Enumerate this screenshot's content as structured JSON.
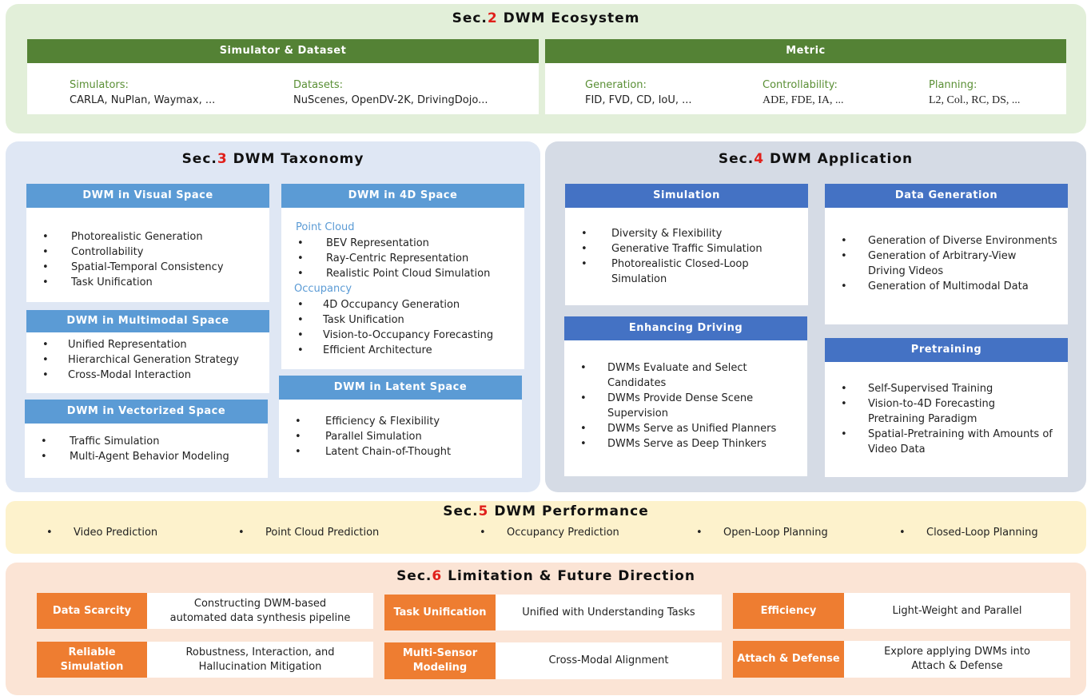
{
  "ecosystem": {
    "title_prefix": "Sec.",
    "num": "2",
    "title": "DWM Ecosystem",
    "sim_header": "Simulator & Dataset",
    "metric_header": "Metric",
    "simulators_label": "Simulators:",
    "simulators_value": "CARLA, NuPlan, Waymax, ...",
    "datasets_label": "Datasets:",
    "datasets_value": "NuScenes, OpenDV-2K, DrivingDojo...",
    "generation_label": "Generation:",
    "generation_value": "FID, FVD, CD, IoU, ...",
    "controllability_label": "Controllability:",
    "controllability_value": "ADE, FDE, IA, ...",
    "planning_label": "Planning:",
    "planning_value": "L2, Col., RC, DS, ..."
  },
  "taxonomy": {
    "title_prefix": "Sec.",
    "num": "3",
    "title": "DWM Taxonomy",
    "visual": {
      "header": "DWM in Visual Space",
      "items": [
        "Photorealistic Generation",
        "Controllability",
        "Spatial-Temporal Consistency",
        "Task Unification"
      ]
    },
    "multimodal": {
      "header": "DWM in Multimodal Space",
      "items": [
        "Unified Representation",
        "Hierarchical Generation Strategy",
        "Cross-Modal Interaction"
      ]
    },
    "vectorized": {
      "header": "DWM in Vectorized Space",
      "items": [
        "Traffic Simulation",
        "Multi-Agent Behavior Modeling"
      ]
    },
    "space4d": {
      "header": "DWM in 4D Space",
      "pc_label": "Point Cloud",
      "pc_items": [
        "BEV Representation",
        "Ray-Centric Representation",
        "Realistic Point Cloud Simulation"
      ],
      "occ_label": "Occupancy",
      "occ_items": [
        "4D Occupancy Generation",
        "Task Unification",
        "Vision-to-Occupancy Forecasting",
        "Efficient Architecture"
      ]
    },
    "latent": {
      "header": "DWM in Latent Space",
      "items": [
        "Efficiency & Flexibility",
        "Parallel Simulation",
        "Latent Chain-of-Thought"
      ]
    }
  },
  "application": {
    "title_prefix": "Sec.",
    "num": "4",
    "title": "DWM Application",
    "simulation": {
      "header": "Simulation",
      "items": [
        "Diversity & Flexibility",
        "Generative Traffic Simulation",
        "Photorealistic Closed-Loop Simulation"
      ]
    },
    "datagen": {
      "header": "Data Generation",
      "items": [
        "Generation of Diverse Environments",
        "Generation of Arbitrary-View Driving Videos",
        "Generation of Multimodal Data"
      ]
    },
    "enhancing": {
      "header": "Enhancing Driving",
      "items": [
        "DWMs Evaluate and Select Candidates",
        "DWMs Provide Dense Scene Supervision",
        "DWMs Serve as Unified Planners",
        "DWMs Serve as Deep Thinkers"
      ]
    },
    "pretraining": {
      "header": "Pretraining",
      "items": [
        "Self-Supervised Training",
        "Vision-to-4D Forecasting Pretraining Paradigm",
        "Spatial-Pretraining with Amounts of Video Data"
      ]
    }
  },
  "performance": {
    "title_prefix": "Sec.",
    "num": "5",
    "title": "DWM Performance",
    "items": [
      "Video Prediction",
      "Point Cloud Prediction",
      "Occupancy Prediction",
      "Open-Loop Planning",
      "Closed-Loop Planning"
    ]
  },
  "limitation": {
    "title_prefix": "Sec.",
    "num": "6",
    "title": "Limitation & Future Direction",
    "cells": [
      {
        "label": "Data Scarcity",
        "text": "Constructing DWM-based\nautomated data synthesis pipeline"
      },
      {
        "label": "Task Unification",
        "text": "Unified with Understanding Tasks"
      },
      {
        "label": "Efficiency",
        "text": "Light-Weight and Parallel"
      },
      {
        "label": "Reliable\nSimulation",
        "text": "Robustness, Interaction, and\nHallucination Mitigation"
      },
      {
        "label": "Multi-Sensor\nModeling",
        "text": "Cross-Modal Alignment"
      },
      {
        "label": "Attach & Defense",
        "text": "Explore applying DWMs into\nAttach & Defense"
      }
    ]
  },
  "colors": {
    "eco_bg": "#e2efd9",
    "eco_header": "#548235",
    "tax_bg": "#dfe7f4",
    "tax_header": "#5b9bd5",
    "app_bg": "#d5dbe5",
    "app_header": "#4472c4",
    "perf_bg": "#fdf2cc",
    "lim_bg": "#fbe4d5",
    "lim_label": "#ee7d31",
    "accent_red": "#e0201b"
  }
}
